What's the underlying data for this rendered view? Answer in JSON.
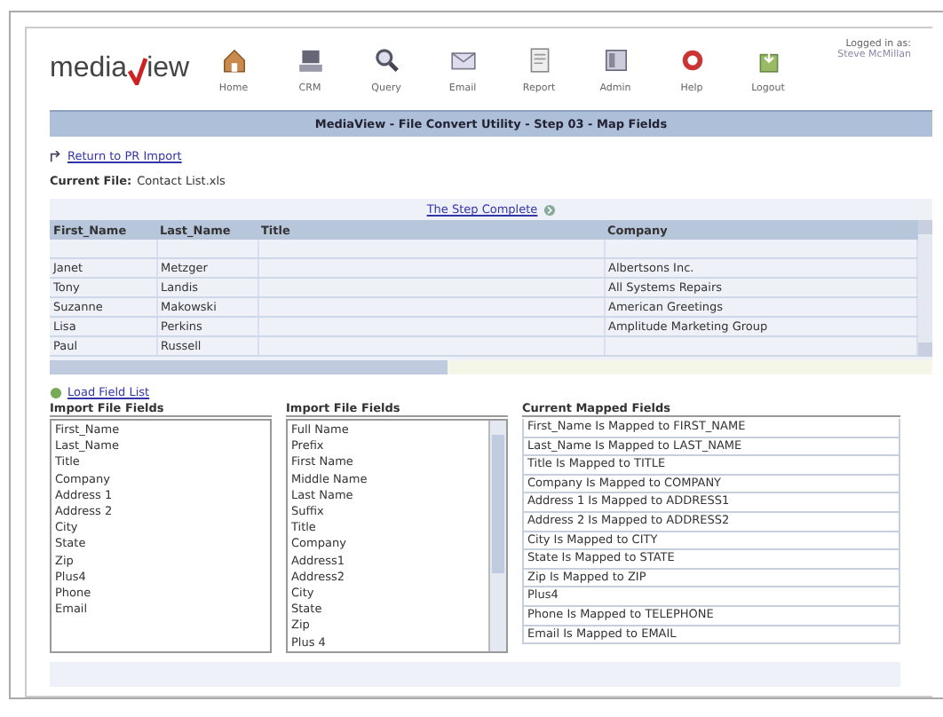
{
  "logo": {
    "text_a": "media",
    "text_b": "iew"
  },
  "nav": [
    {
      "label": "Home"
    },
    {
      "label": "CRM"
    },
    {
      "label": "Query"
    },
    {
      "label": "Email"
    },
    {
      "label": "Report"
    },
    {
      "label": "Admin"
    },
    {
      "label": "Help"
    },
    {
      "label": "Logout"
    }
  ],
  "user": {
    "label": "Logged in as:",
    "name": "Steve McMillan"
  },
  "title": "MediaView - File Convert Utility - Step 03 - Map Fields",
  "return_link": "Return to PR Import",
  "current_file": {
    "label": "Current File:",
    "value": "Contact List.xls"
  },
  "next_step": "The Step Complete",
  "table": {
    "columns": [
      "First_Name",
      "Last_Name",
      "Title",
      "Company"
    ],
    "rows": [
      [
        "",
        "",
        "",
        ""
      ],
      [
        "Janet",
        "Metzger",
        "",
        "Albertsons Inc."
      ],
      [
        "Tony",
        "Landis",
        "",
        "All Systems Repairs"
      ],
      [
        "Suzanne",
        "Makowski",
        "",
        "American Greetings"
      ],
      [
        "Lisa",
        "Perkins",
        "",
        "Amplitude Marketing Group"
      ],
      [
        "Paul",
        "Russell",
        "",
        ""
      ]
    ]
  },
  "load_link": "Load Field List",
  "import_fields": {
    "heading": "Import File Fields",
    "items": [
      "First_Name",
      "Last_Name",
      "Title",
      "Company",
      "Address 1",
      "Address 2",
      "City",
      "State",
      "Zip",
      "Plus4",
      "Phone",
      "Email"
    ]
  },
  "target_fields": {
    "heading": "Import File Fields",
    "items": [
      "Full Name",
      "Prefix",
      "First Name",
      "Middle Name",
      "Last Name",
      "Suffix",
      "Title",
      "Company",
      "Address1",
      "Address2",
      "City",
      "State",
      "Zip",
      "Plus 4"
    ]
  },
  "mapped": {
    "heading": "Current Mapped Fields",
    "items": [
      "First_Name Is Mapped to FIRST_NAME",
      "Last_Name Is Mapped to LAST_NAME",
      "Title Is Mapped to TITLE",
      "Company Is Mapped to COMPANY",
      "Address 1 Is Mapped to ADDRESS1",
      "Address 2 Is Mapped to ADDRESS2",
      "City Is Mapped to CITY",
      "State Is Mapped to STATE",
      "Zip Is Mapped to ZIP",
      "Plus4",
      "Phone Is Mapped to TELEPHONE",
      "Email Is Mapped to EMAIL"
    ]
  }
}
